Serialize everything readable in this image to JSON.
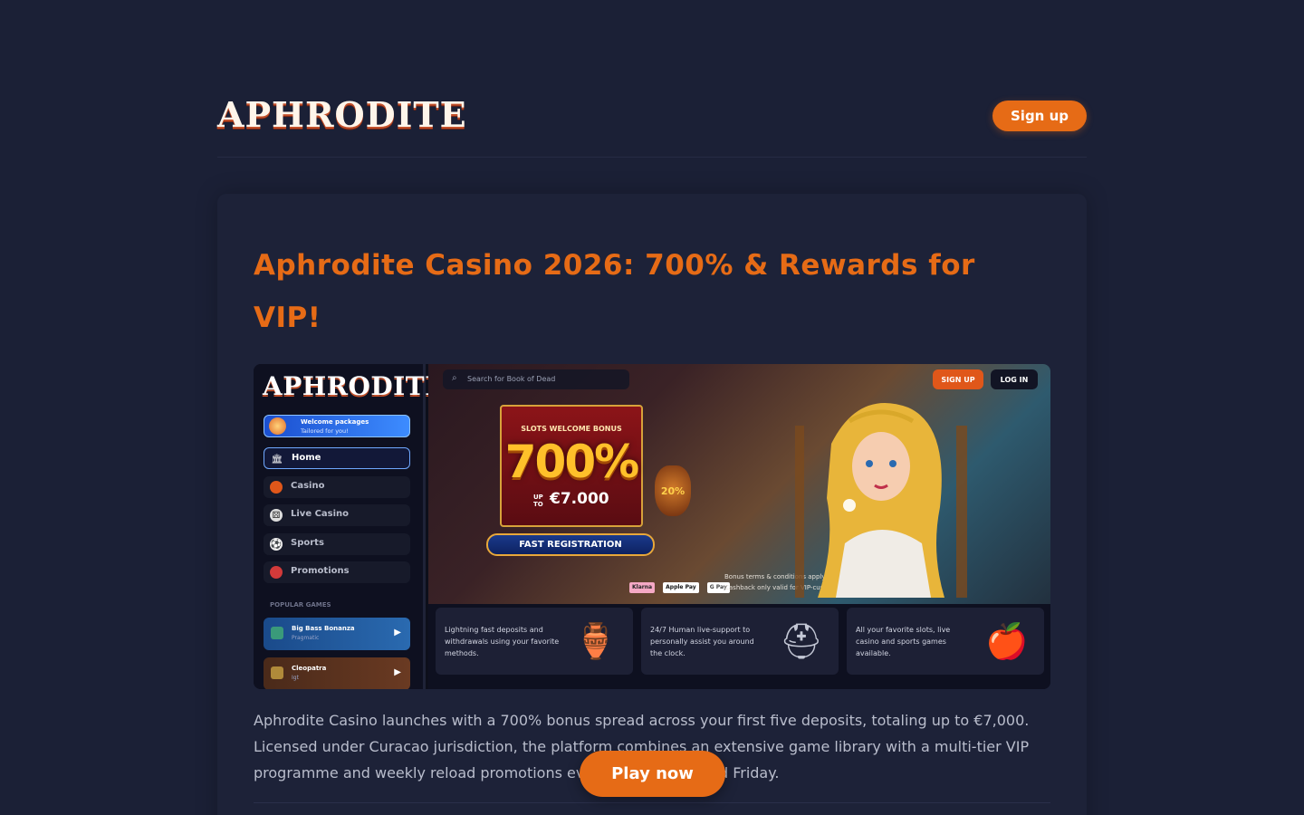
{
  "header": {
    "logo_text": "APHRODITE",
    "signup_label": "Sign up"
  },
  "article": {
    "title": "Aphrodite Casino 2026: 700% & Rewards for VIP!",
    "description": "Aphrodite Casino launches with a 700% bonus spread across your first five deposits, totaling up to €7,000. Licensed under Curacao jurisdiction, the platform combines an extensive game library with a multi-tier VIP programme and weekly reload promotions every Wednesday and Friday."
  },
  "screenshot": {
    "sidebar": {
      "logo_text": "APHRODITE",
      "welcome_title": "Welcome packages",
      "welcome_sub": "Tailored for you!",
      "nav": [
        {
          "label": "Home",
          "icon": "temple-icon"
        },
        {
          "label": "Casino",
          "icon": "chip-icon"
        },
        {
          "label": "Live Casino",
          "icon": "dice-icon"
        },
        {
          "label": "Sports",
          "icon": "football-icon"
        },
        {
          "label": "Promotions",
          "icon": "watermelon-icon"
        }
      ],
      "popular_label": "POPULAR GAMES",
      "games": [
        {
          "title": "Big Bass Bonanza",
          "provider": "Pragmatic"
        },
        {
          "title": "Cleopatra",
          "provider": "Igt"
        }
      ]
    },
    "hero": {
      "search_placeholder": "Search for Book of Dead",
      "signup_label": "SIGN UP",
      "login_label": "LOG IN",
      "bonus_title": "SLOTS WELCOME BONUS",
      "bonus_percent": "700%",
      "up_to": "UP TO",
      "bonus_amount": "€7.000",
      "cta": "FAST REGISTRATION",
      "vase_text": "20%",
      "payments": [
        "Klarna",
        "Apple Pay",
        "G Pay"
      ],
      "terms_line1": "Bonus terms & conditions apply.",
      "terms_line2": "Cashback only valid for VIP-customers."
    },
    "features": [
      {
        "text": "Lightning fast deposits and withdrawals using your favorite methods.",
        "icon": "gold-vase-icon"
      },
      {
        "text": "24/7 Human live-support to personally assist you around the clock.",
        "icon": "helmet-icon"
      },
      {
        "text": "All your favorite slots, live casino and sports games available.",
        "icon": "fruit-basket-icon"
      }
    ]
  },
  "play_label": "Play now",
  "colors": {
    "background": "#1b2036",
    "accent": "#e66b16"
  }
}
